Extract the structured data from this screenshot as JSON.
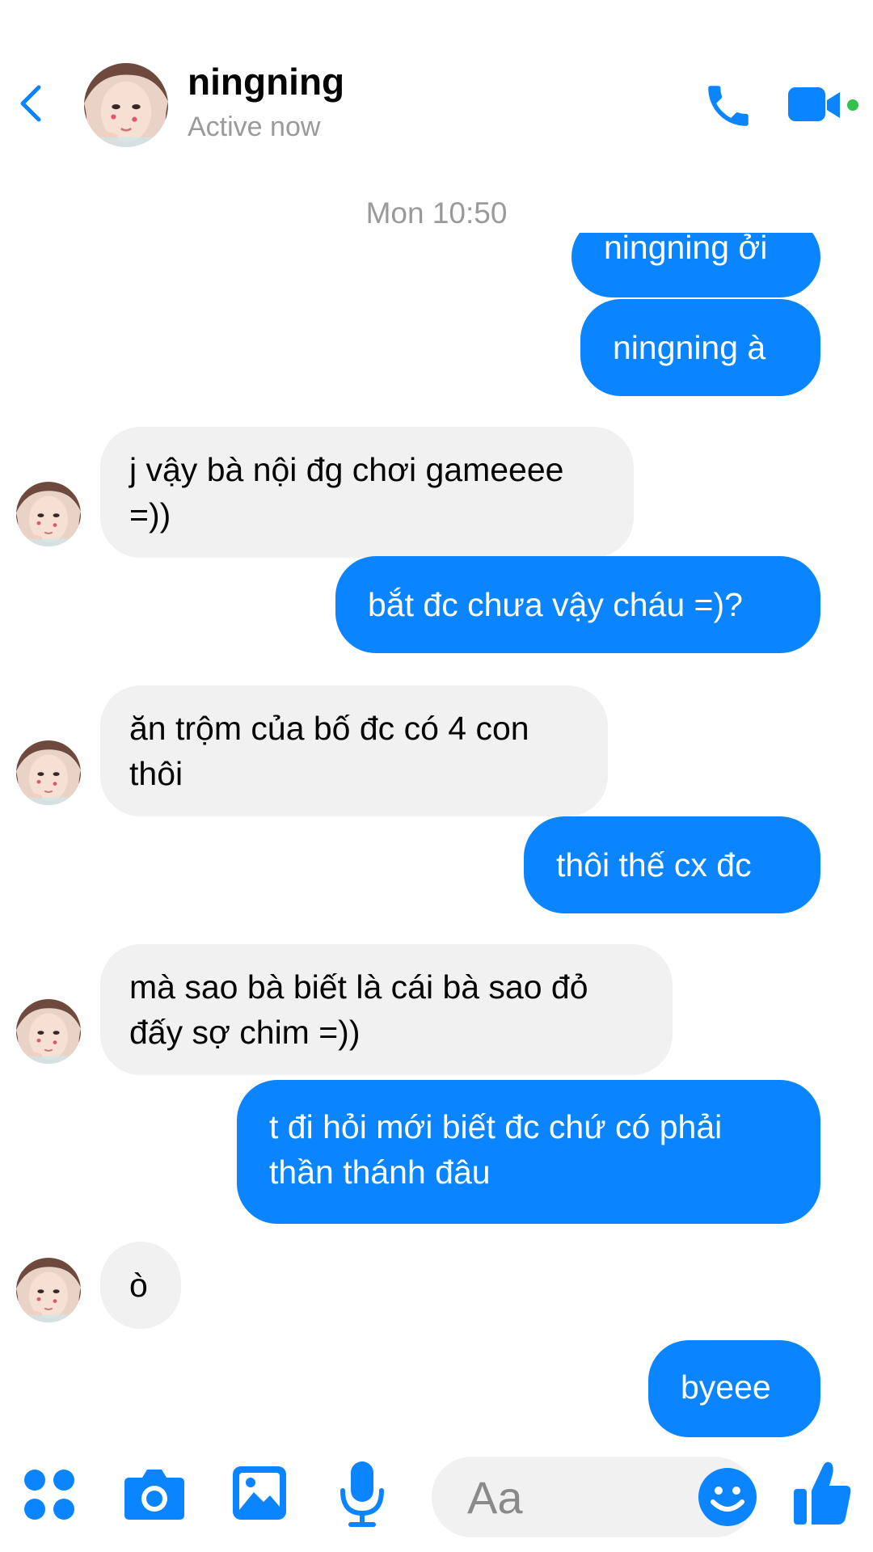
{
  "header": {
    "name": "ningning",
    "status": "Active now"
  },
  "conversation": {
    "timestamp": "Mon 10:50",
    "messages": [
      {
        "sender": "me",
        "text": "ningning ởi"
      },
      {
        "sender": "me",
        "text": "ningning à"
      },
      {
        "sender": "them",
        "text": "j vậy bà nội đg chơi gameeee =))"
      },
      {
        "sender": "me",
        "text": "bắt đc chưa vậy cháu =)?"
      },
      {
        "sender": "them",
        "text": "ăn trộm của bố đc có 4 con thôi"
      },
      {
        "sender": "me",
        "text": "thôi thế cx đc"
      },
      {
        "sender": "them",
        "text": "mà sao bà biết là cái bà sao đỏ đấy sợ chim =))"
      },
      {
        "sender": "me",
        "text": "t đi hỏi mới biết đc chứ có phải thần thánh đâu"
      },
      {
        "sender": "them",
        "text": "ò"
      },
      {
        "sender": "me",
        "text": "byeee"
      }
    ]
  },
  "composer": {
    "placeholder": "Aa"
  },
  "colors": {
    "accent": "#0a84ff",
    "incoming_bubble": "#f1f1f1",
    "online_dot": "#31c24d"
  },
  "icons": [
    "back-chevron-icon",
    "phone-icon",
    "video-camera-icon",
    "apps-grid-icon",
    "camera-icon",
    "gallery-icon",
    "microphone-icon",
    "emoji-icon",
    "thumbs-up-icon"
  ]
}
